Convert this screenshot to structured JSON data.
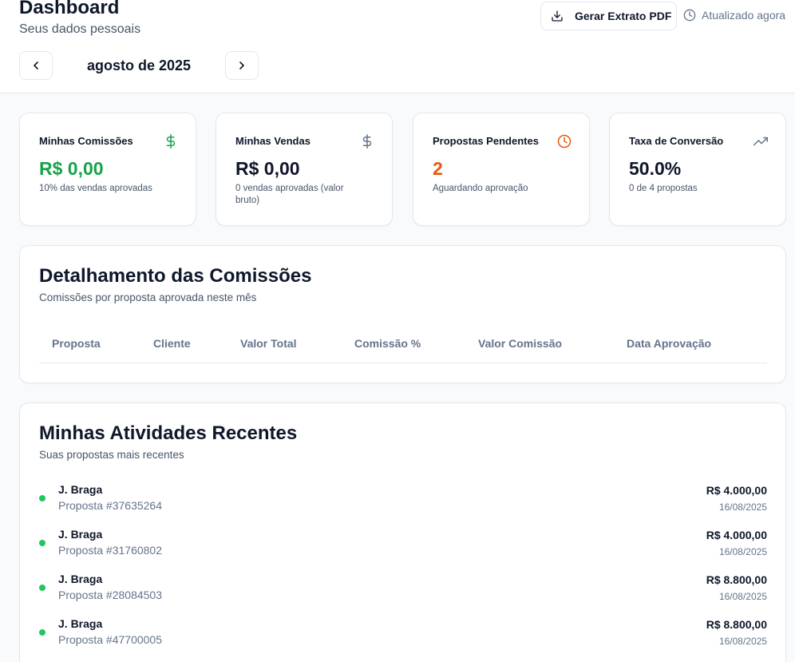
{
  "header": {
    "title": "Dashboard",
    "subtitle": "Seus dados pessoais",
    "pdf_button": "Gerar Extrato PDF",
    "updated": "Atualizado agora",
    "month": "agosto de 2025"
  },
  "colors": {
    "green": "#16a34a",
    "orange": "#ea580c",
    "dot": "#22c55e"
  },
  "stats": [
    {
      "label": "Minhas Comissões",
      "value": "R$ 0,00",
      "desc": "10% das vendas aprovadas",
      "icon": "dollar-icon"
    },
    {
      "label": "Minhas Vendas",
      "value": "R$ 0,00",
      "desc": "0 vendas aprovadas (valor bruto)",
      "icon": "dollar-icon"
    },
    {
      "label": "Propostas Pendentes",
      "value": "2",
      "desc": "Aguardando aprovação",
      "icon": "clock-icon"
    },
    {
      "label": "Taxa de Conversão",
      "value": "50.0%",
      "desc": "0 de 4 propostas",
      "icon": "trending-up-icon"
    }
  ],
  "commissions": {
    "title": "Detalhamento das Comissões",
    "subtitle": "Comissões por proposta aprovada neste mês",
    "columns": [
      "Proposta",
      "Cliente",
      "Valor Total",
      "Comissão %",
      "Valor Comissão",
      "Data Aprovação"
    ]
  },
  "activities": {
    "title": "Minhas Atividades Recentes",
    "subtitle": "Suas propostas mais recentes",
    "items": [
      {
        "name": "J. Braga",
        "proposal": "Proposta #37635264",
        "amount": "R$ 4.000,00",
        "date": "16/08/2025"
      },
      {
        "name": "J. Braga",
        "proposal": "Proposta #31760802",
        "amount": "R$ 4.000,00",
        "date": "16/08/2025"
      },
      {
        "name": "J. Braga",
        "proposal": "Proposta #28084503",
        "amount": "R$ 8.800,00",
        "date": "16/08/2025"
      },
      {
        "name": "J. Braga",
        "proposal": "Proposta #47700005",
        "amount": "R$ 8.800,00",
        "date": "16/08/2025"
      }
    ]
  }
}
